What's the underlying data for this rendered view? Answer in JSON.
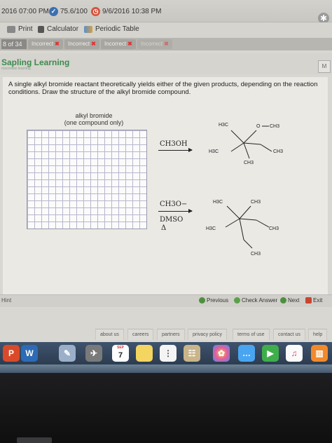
{
  "topbar": {
    "time_left": "2016 07:00 PM",
    "score": "75.6/100",
    "due_date": "9/6/2016 10:38 PM"
  },
  "toolbar": {
    "print": "Print",
    "calculator": "Calculator",
    "periodic_table": "Periodic Table"
  },
  "attempts": {
    "question_count": "8 of 34",
    "badges": [
      "Incorrect",
      "Incorrect",
      "Incorrect",
      "Incorrect"
    ]
  },
  "app": {
    "logo": "Sapling Learning",
    "logo_sub": "macmillan learning",
    "menu_button": "M"
  },
  "question": {
    "text": "A single alkyl bromide reactant theoretically yields either of the given products, depending on the reaction conditions. Draw the structure of the alkyl bromide compound.",
    "canvas_label_1": "alkyl bromide",
    "canvas_label_2": "(one compound only)"
  },
  "reactions": {
    "reagent1": "CH3OH",
    "reagent2_line1": "CH3O−",
    "reagent2_line2": "DMSO",
    "reagent2_line3": "Δ"
  },
  "molecule_labels": {
    "p1_h3c_top": "H3C",
    "p1_o": "O",
    "p1_ch3_ether": "CH3",
    "p1_h3c_left": "H3C",
    "p1_ch3_right": "CH3",
    "p1_ch3_bottom": "CH3",
    "p2_h3c_top": "H3C",
    "p2_ch3_top": "CH3",
    "p2_h3c_left": "H3C",
    "p2_ch3_right": "CH3",
    "p2_ch3_bottom": "CH3"
  },
  "navigation": {
    "hint": "Hint",
    "previous": "Previous",
    "check_answer": "Check Answer",
    "next": "Next",
    "exit": "Exit"
  },
  "footer_links": [
    "about us",
    "careers",
    "partners",
    "privacy policy",
    "terms of use",
    "contact us",
    "help"
  ],
  "dock": {
    "calendar_month": "SEP",
    "calendar_day": "7"
  }
}
